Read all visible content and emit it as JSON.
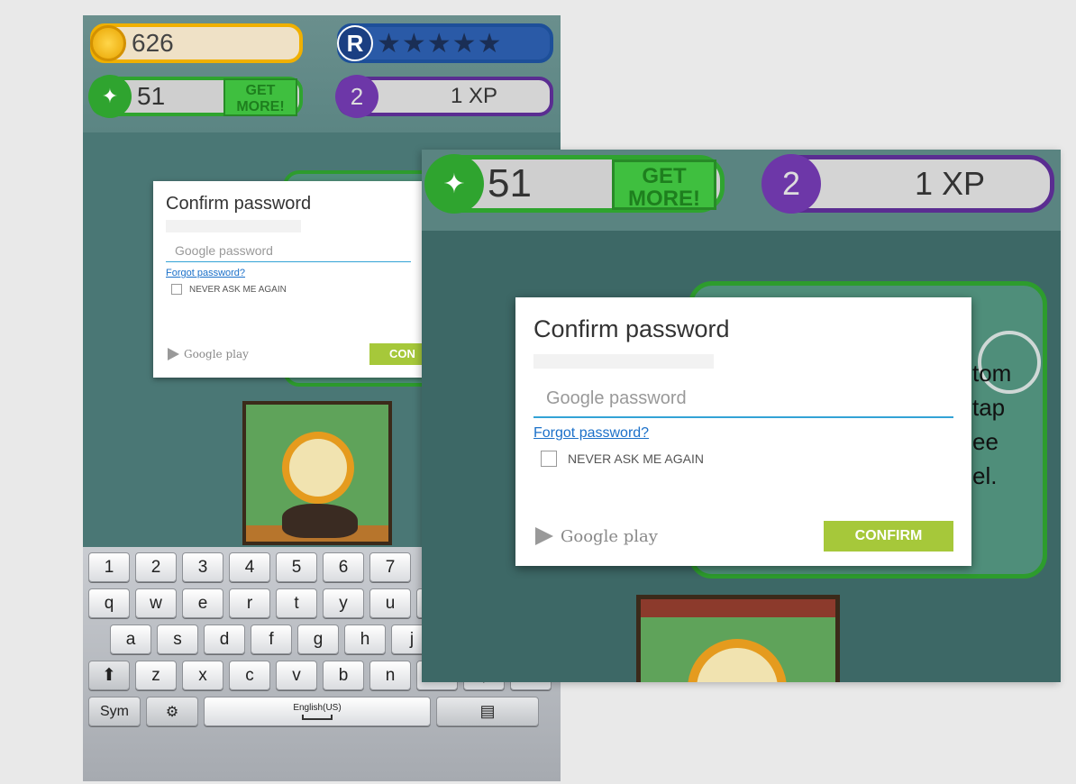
{
  "game": {
    "coins": "626",
    "rating_badge": "R",
    "rating_stars": "★★★★★",
    "bones": "51",
    "get_more_label_line1": "GET",
    "get_more_label_line2": "MORE!",
    "level": "2",
    "xp": "1 XP",
    "panel_text_right": "tom\ntap\nee\nel."
  },
  "dialog": {
    "title": "Confirm password",
    "password_placeholder": "Google password",
    "forgot_link": "Forgot password?",
    "never_ask_label": "NEVER ASK ME AGAIN",
    "brand": "Google play",
    "confirm_button": "CONFIRM",
    "confirm_button_cropped": "CON"
  },
  "keyboard": {
    "number_row": [
      "1",
      "2",
      "3",
      "4",
      "5",
      "6",
      "7"
    ],
    "row1": [
      "q",
      "w",
      "e",
      "r",
      "t",
      "y",
      "u",
      "i"
    ],
    "row2": [
      "a",
      "s",
      "d",
      "f",
      "g",
      "h",
      "j",
      "k"
    ],
    "row3": [
      "z",
      "x",
      "c",
      "v",
      "b",
      "n",
      "m",
      ",",
      "."
    ],
    "sym_label": "Sym",
    "space_label": "English(US)"
  },
  "colors": {
    "accent_green": "#a6c83a",
    "link_blue": "#1b70c9",
    "field_underline": "#33a3d6"
  }
}
